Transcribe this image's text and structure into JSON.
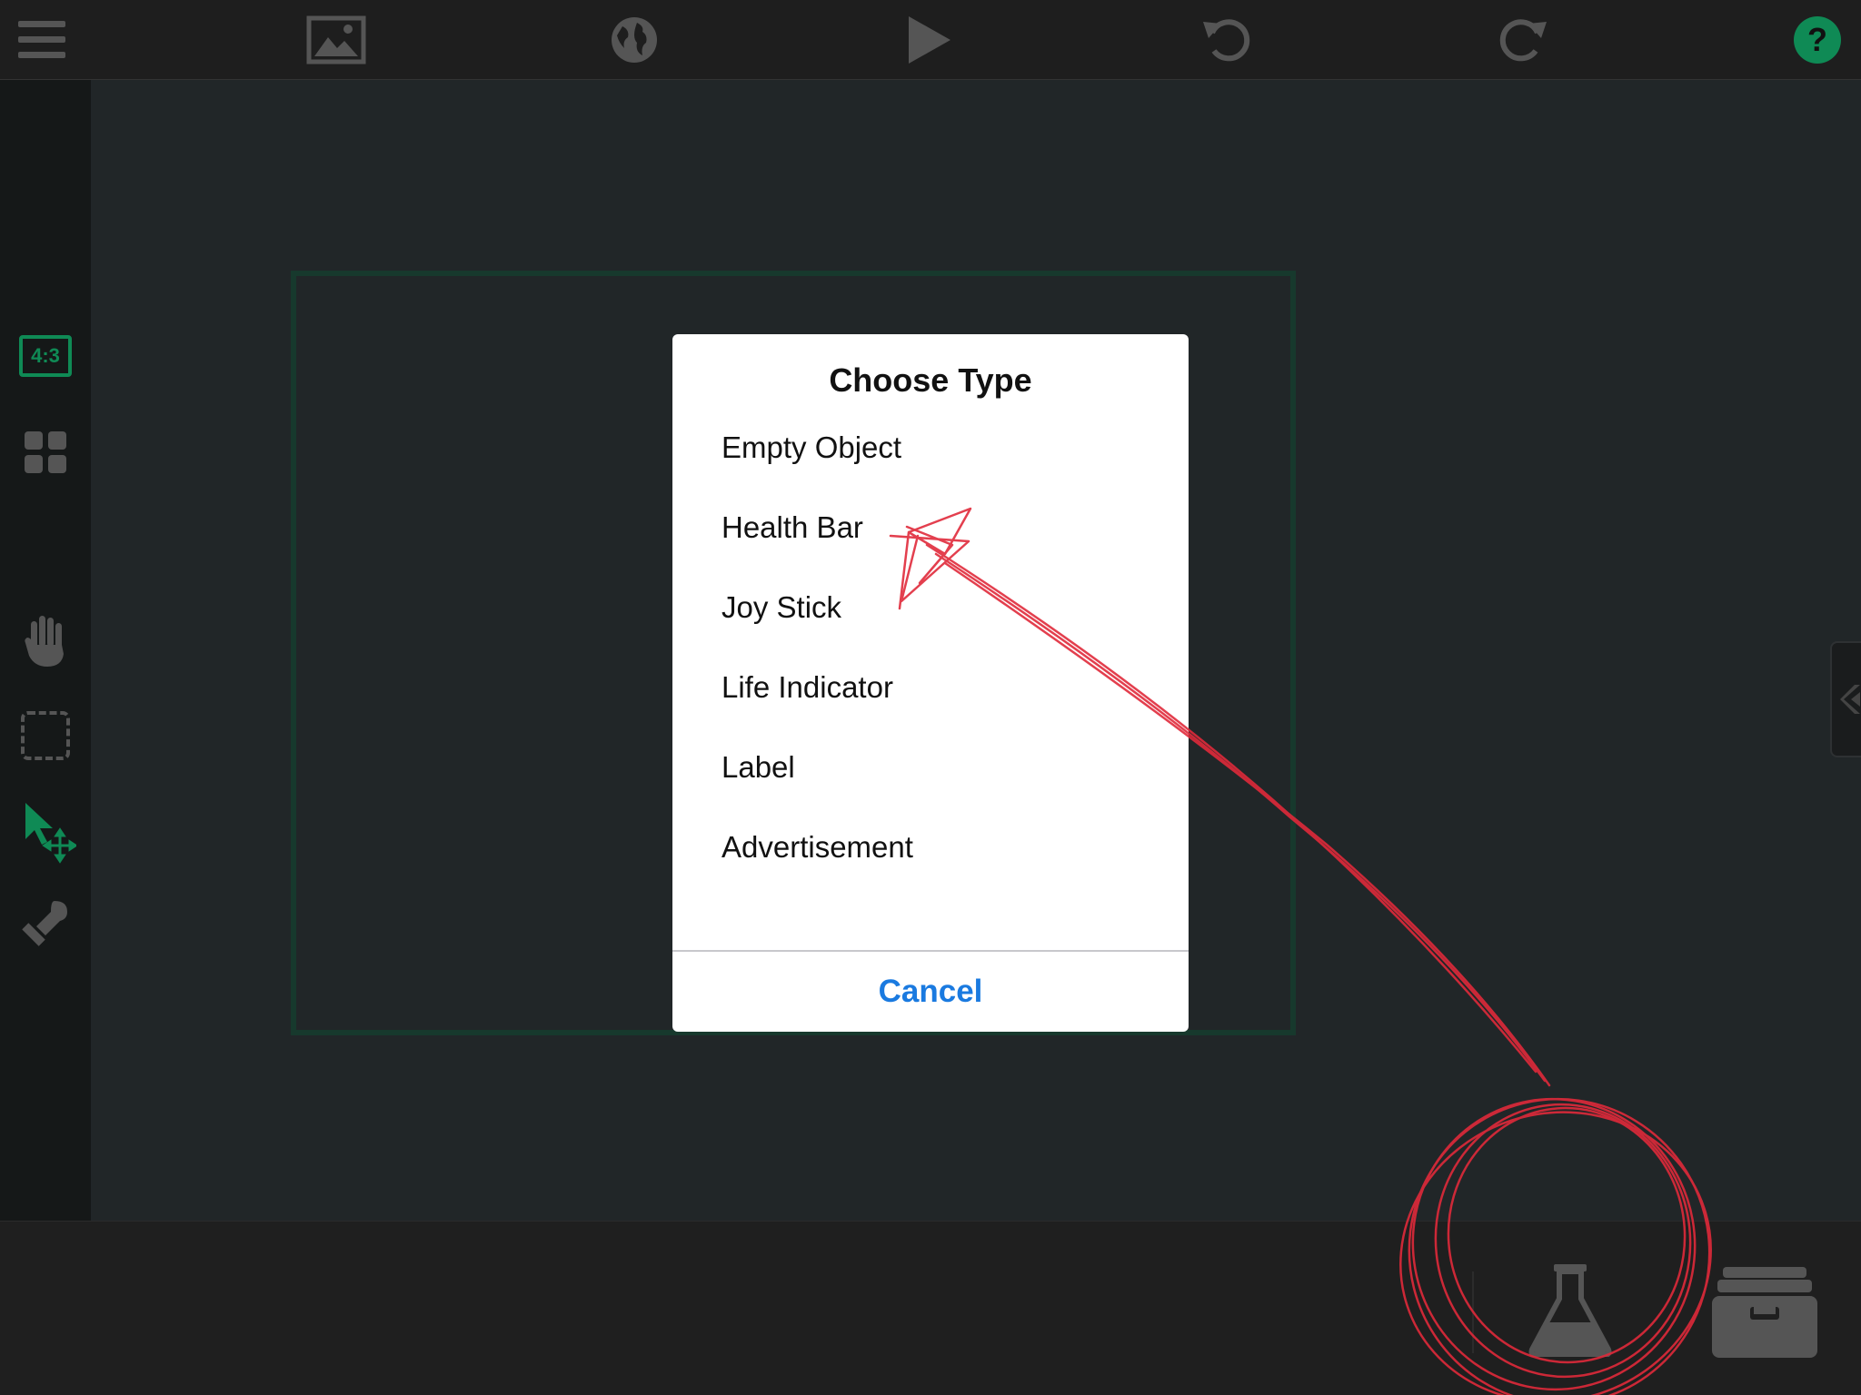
{
  "toolbar": {
    "icons": [
      "menu-icon",
      "image-icon",
      "globe-icon",
      "play-icon",
      "undo-icon",
      "redo-icon",
      "help-icon"
    ]
  },
  "sidebar": {
    "aspect_badge": "4:3",
    "icons": [
      "aspect-ratio-icon",
      "grid-icon",
      "hand-icon",
      "selection-box-icon",
      "select-move-icon",
      "stamp-icon"
    ]
  },
  "dialog": {
    "title": "Choose Type",
    "items": [
      {
        "label": "Empty Object"
      },
      {
        "label": "Health Bar"
      },
      {
        "label": "Joy Stick"
      },
      {
        "label": "Life Indicator"
      },
      {
        "label": "Label"
      },
      {
        "label": "Advertisement"
      }
    ],
    "cancel_label": "Cancel"
  },
  "bottombar": {
    "icons": [
      "flask-icon",
      "archive-box-icon"
    ]
  },
  "colors": {
    "accent": "#0f8a55",
    "annotation": "#e02a3a",
    "dialog_link": "#1a7ae0",
    "icon_gray": "#555555"
  }
}
